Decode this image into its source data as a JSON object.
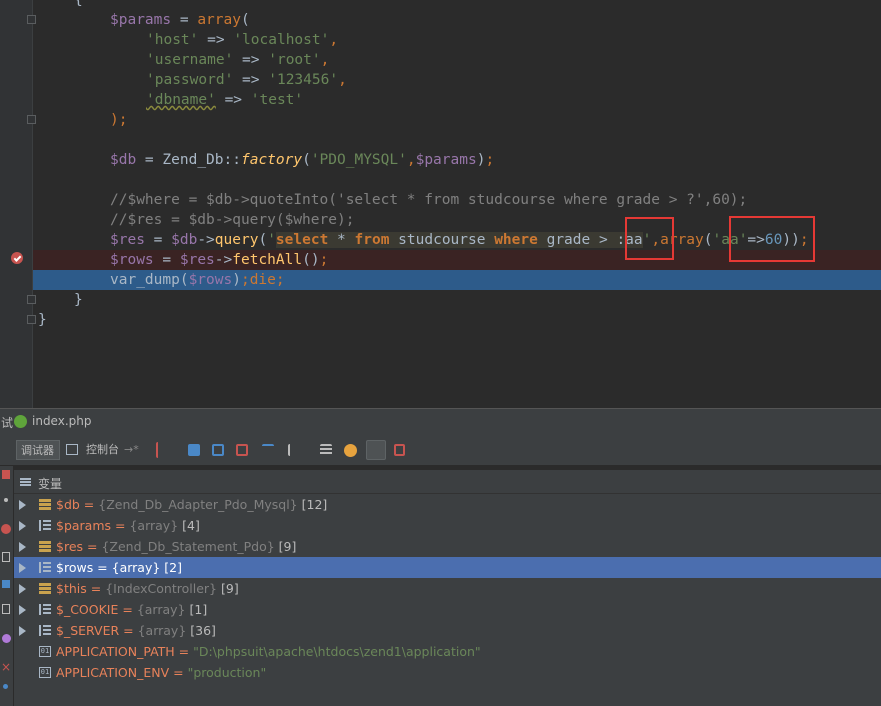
{
  "editor": {
    "lines": {
      "l1": "{",
      "l2_var": "$params",
      "l2_fn": "array",
      "host_key": "'host'",
      "host_val": "'localhost'",
      "user_key": "'username'",
      "user_val": "'root'",
      "pass_key": "'password'",
      "pass_val": "'123456'",
      "db_key": "'dbname'",
      "db_val": "'test'",
      "close_paren": ");",
      "db_var": "$db",
      "db_class": "Zend_Db",
      "db_factory": "factory",
      "db_adapter": "'PDO_MYSQL'",
      "db_params": "$params",
      "cmt1": "//$where = $db->quoteInto('select * from studcourse where grade > ?',60);",
      "cmt2": "//$res = $db->query($where);",
      "res_var": "$res",
      "res_db": "$db",
      "res_query": "query",
      "sql_select": "select",
      "sql_mid1": " * ",
      "sql_from": "from",
      "sql_mid2": " studcourse ",
      "sql_where": "where",
      "sql_mid3": " grade > ",
      "sql_aa": ":aa",
      "res_array": "array",
      "res_aa_key": "'aa'",
      "res_aa_val": "60",
      "rows_var": "$rows",
      "rows_res": "$res",
      "rows_fetch": "fetchAll",
      "dump_fn": "var_dump",
      "dump_arg": "$rows",
      "dump_die": "die",
      "brace_close": "}",
      "class_close": "}"
    }
  },
  "debug": {
    "title_prefix": "试",
    "file": "index.php",
    "tab_debugger": "调试器",
    "tab_console": "控制台",
    "variables_label": "变量",
    "vars": [
      {
        "name": "$db",
        "value": "{Zend_Db_Adapter_Pdo_Mysql}",
        "count": "[12]"
      },
      {
        "name": "$params",
        "value": "{array}",
        "count": "[4]"
      },
      {
        "name": "$res",
        "value": "{Zend_Db_Statement_Pdo}",
        "count": "[9]"
      },
      {
        "name": "$rows",
        "value": "{array}",
        "count": "[2]"
      },
      {
        "name": "$this",
        "value": "{IndexController}",
        "count": "[9]"
      },
      {
        "name": "$_COOKIE",
        "value": "{array}",
        "count": "[1]"
      },
      {
        "name": "$_SERVER",
        "value": "{array}",
        "count": "[36]"
      },
      {
        "name": "APPLICATION_PATH",
        "value": "\"D:\\phpsuit\\apache\\htdocs\\zend1\\application\""
      },
      {
        "name": "APPLICATION_ENV",
        "value": "\"production\""
      }
    ]
  },
  "colors": {
    "accent_selection": "#4b6eaf",
    "breakpoint": "#c75450",
    "highlight_box": "#e53935"
  }
}
